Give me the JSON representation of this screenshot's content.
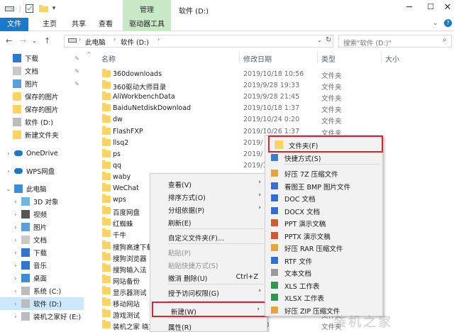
{
  "window": {
    "title": "软件 (D:)",
    "manage_tab": "管理"
  },
  "ribbon": {
    "tabs": [
      "文件",
      "主页",
      "共享",
      "查看",
      "驱动器工具"
    ]
  },
  "address": {
    "segments": [
      "此电脑",
      "软件 (D:)"
    ],
    "search_placeholder": "搜索\"软件 (D:)\""
  },
  "columns": {
    "name": "名称",
    "date": "修改日期",
    "type": "类型",
    "size": "大小"
  },
  "sidebar": [
    {
      "label": "下载",
      "pinned": true,
      "icon": "download-icon"
    },
    {
      "label": "文档",
      "pinned": true,
      "icon": "document-icon"
    },
    {
      "label": "图片",
      "pinned": true,
      "icon": "picture-icon"
    },
    {
      "label": "保存的图片",
      "icon": "folder-icon"
    },
    {
      "label": "保存的图片",
      "icon": "folder-icon"
    },
    {
      "label": "软件 (D:)",
      "icon": "drive-icon"
    },
    {
      "label": "新建文件夹",
      "icon": "folder-icon"
    },
    {
      "label": "OneDrive",
      "icon": "cloud-icon"
    },
    {
      "label": "WPS网盘",
      "icon": "cloud-icon"
    },
    {
      "label": "此电脑",
      "icon": "computer-icon"
    },
    {
      "label": "3D 对象",
      "icon": "cube-icon"
    },
    {
      "label": "视频",
      "icon": "video-icon"
    },
    {
      "label": "图片",
      "icon": "picture-icon"
    },
    {
      "label": "文档",
      "icon": "document-icon"
    },
    {
      "label": "下载",
      "icon": "download-icon"
    },
    {
      "label": "音乐",
      "icon": "music-icon"
    },
    {
      "label": "桌面",
      "icon": "desktop-icon"
    },
    {
      "label": "系统 (C:)",
      "icon": "drive-icon"
    },
    {
      "label": "软件 (D:)",
      "icon": "drive-icon",
      "selected": true
    },
    {
      "label": "装机之家好 (E:)",
      "icon": "drive-icon"
    }
  ],
  "files": [
    {
      "name": "360downloads",
      "date": "2019/10/18 10:56",
      "type": "文件夹"
    },
    {
      "name": "360驱动大师目录",
      "date": "2019/9/28 19:33",
      "type": "文件夹"
    },
    {
      "name": "AliWorkbenchData",
      "date": "2019/9/28 21:45",
      "type": "文件夹"
    },
    {
      "name": "BaiduNetdiskDownload",
      "date": "2019/10/18 1:37",
      "type": "文件夹"
    },
    {
      "name": "dw",
      "date": "2019/10/24 0:20",
      "type": "文件夹"
    },
    {
      "name": "FlashFXP",
      "date": "2019/10/26 1:37",
      "type": "文件夹"
    },
    {
      "name": "llsq2",
      "date": "2019/",
      "type": ""
    },
    {
      "name": "ps",
      "date": "2019/",
      "type": ""
    },
    {
      "name": "qq",
      "date": "2019/1",
      "type": ""
    },
    {
      "name": "waby",
      "date": "",
      "type": ""
    },
    {
      "name": "WeChat",
      "date": "",
      "type": ""
    },
    {
      "name": "wps",
      "date": "",
      "type": ""
    },
    {
      "name": "百度网盘",
      "date": "",
      "type": ""
    },
    {
      "name": "红蜘蛛",
      "date": "",
      "type": ""
    },
    {
      "name": "千牛",
      "date": "",
      "type": ""
    },
    {
      "name": "搜狗高速下载",
      "date": "",
      "type": ""
    },
    {
      "name": "搜狗浏览器",
      "date": "",
      "type": ""
    },
    {
      "name": "搜狗输入法",
      "date": "",
      "type": ""
    },
    {
      "name": "网站备份",
      "date": "",
      "type": ""
    },
    {
      "name": "显示器测试",
      "date": "",
      "type": ""
    },
    {
      "name": "移动网站",
      "date": "",
      "type": ""
    },
    {
      "name": "游戏测试",
      "date": "",
      "type": "文件夹"
    },
    {
      "name": "装机之家 晓东",
      "date": "29 0:10",
      "type": "文件夹"
    }
  ],
  "context_menu": [
    {
      "label": "查看(V)",
      "arrow": true
    },
    {
      "label": "排序方式(O)",
      "arrow": true
    },
    {
      "label": "分组依据(P)",
      "arrow": true
    },
    {
      "label": "刷新(E)"
    },
    {
      "label": "自定义文件夹(F)..."
    },
    {
      "label": "粘贴(P)",
      "disabled": true
    },
    {
      "label": "粘贴快捷方式(S)",
      "disabled": true
    },
    {
      "label": "撤消 删除(U)",
      "shortcut": "Ctrl+Z"
    },
    {
      "label": "授予访问权限(G)",
      "arrow": true
    },
    {
      "label": "新建(W)",
      "arrow": true,
      "highlight": true
    },
    {
      "label": "属性(R)"
    }
  ],
  "submenu": [
    {
      "label": "文件夹(F)",
      "icon": "folder-icon",
      "color": "#ffd45e"
    },
    {
      "label": "快捷方式(S)",
      "icon": "shortcut-icon",
      "color": "#3a7bd5"
    },
    {
      "label": "好压 7Z 压缩文件",
      "icon": "archive-icon",
      "color": "#e8a33a"
    },
    {
      "label": "看图王 BMP 图片文件",
      "icon": "image-icon",
      "color": "#3a6fd5"
    },
    {
      "label": "DOC 文档",
      "icon": "doc-icon",
      "color": "#2f6fd6"
    },
    {
      "label": "DOCX 文档",
      "icon": "doc-icon",
      "color": "#2f6fd6"
    },
    {
      "label": "PPT 演示文稿",
      "icon": "ppt-icon",
      "color": "#d9572f"
    },
    {
      "label": "PPTX 演示文稿",
      "icon": "ppt-icon",
      "color": "#d9572f"
    },
    {
      "label": "好压 RAR 压缩文件",
      "icon": "archive-icon",
      "color": "#e8a33a"
    },
    {
      "label": "RTF 文件",
      "icon": "doc-icon",
      "color": "#2f6fd6"
    },
    {
      "label": "文本文档",
      "icon": "text-icon",
      "color": "#9a9a9a"
    },
    {
      "label": "XLS 工作表",
      "icon": "xls-icon",
      "color": "#2b9a4a"
    },
    {
      "label": "XLSX 工作表",
      "icon": "xls-icon",
      "color": "#2b9a4a"
    },
    {
      "label": "好压 ZIP 压缩文件",
      "icon": "archive-icon",
      "color": "#e8a33a"
    }
  ],
  "watermark": "装机之家"
}
